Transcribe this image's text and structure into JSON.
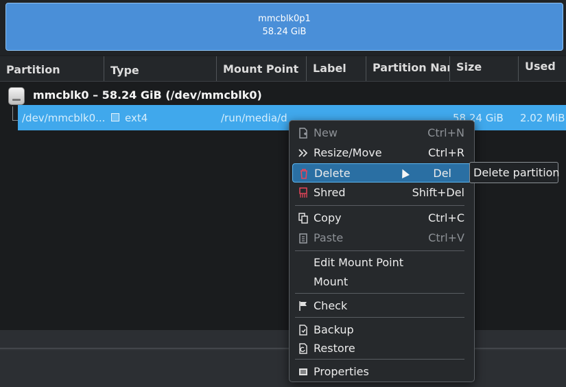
{
  "partition_bar": {
    "name": "mmcblk0p1",
    "size": "58.24 GiB"
  },
  "columns": [
    "Partition",
    "Type",
    "Mount Point",
    "Label",
    "Partition Nam",
    "Size",
    "Used"
  ],
  "disk": {
    "label": "mmcblk0 – 58.24 GiB (/dev/mmcblk0)",
    "icon": "disk-drive-icon"
  },
  "partition_row": {
    "partition": "/dev/mmcblk0...",
    "type": "ext4",
    "mount_point": "/run/media/d",
    "size": "58.24 GiB",
    "used": "2.02 MiB",
    "colors": {
      "selection": "#40a8ec"
    }
  },
  "context_menu": {
    "items": [
      {
        "label": "New",
        "shortcut": "Ctrl+N",
        "icon": "new-icon",
        "enabled": false
      },
      {
        "label": "Resize/Move",
        "shortcut": "Ctrl+R",
        "icon": "resize-move-icon",
        "enabled": true
      },
      {
        "label": "Delete",
        "shortcut": "Del",
        "icon": "trash-icon",
        "enabled": true,
        "highlighted": true
      },
      {
        "label": "Shred",
        "shortcut": "Shift+Del",
        "icon": "shred-icon",
        "enabled": true
      },
      {
        "label": "Copy",
        "shortcut": "Ctrl+C",
        "icon": "copy-icon",
        "enabled": true
      },
      {
        "label": "Paste",
        "shortcut": "Ctrl+V",
        "icon": "paste-icon",
        "enabled": false
      },
      {
        "label": "Edit Mount Point",
        "shortcut": "",
        "icon": "",
        "enabled": true
      },
      {
        "label": "Mount",
        "shortcut": "",
        "icon": "",
        "enabled": true
      },
      {
        "label": "Check",
        "shortcut": "",
        "icon": "flag-icon",
        "enabled": true
      },
      {
        "label": "Backup",
        "shortcut": "",
        "icon": "backup-icon",
        "enabled": true
      },
      {
        "label": "Restore",
        "shortcut": "",
        "icon": "restore-icon",
        "enabled": true
      },
      {
        "label": "Properties",
        "shortcut": "",
        "icon": "properties-icon",
        "enabled": true
      }
    ],
    "colors": {
      "highlight": "#2a6fa3",
      "delete_icon": "#e8455a"
    }
  },
  "tooltip": {
    "text": "Delete partition"
  }
}
